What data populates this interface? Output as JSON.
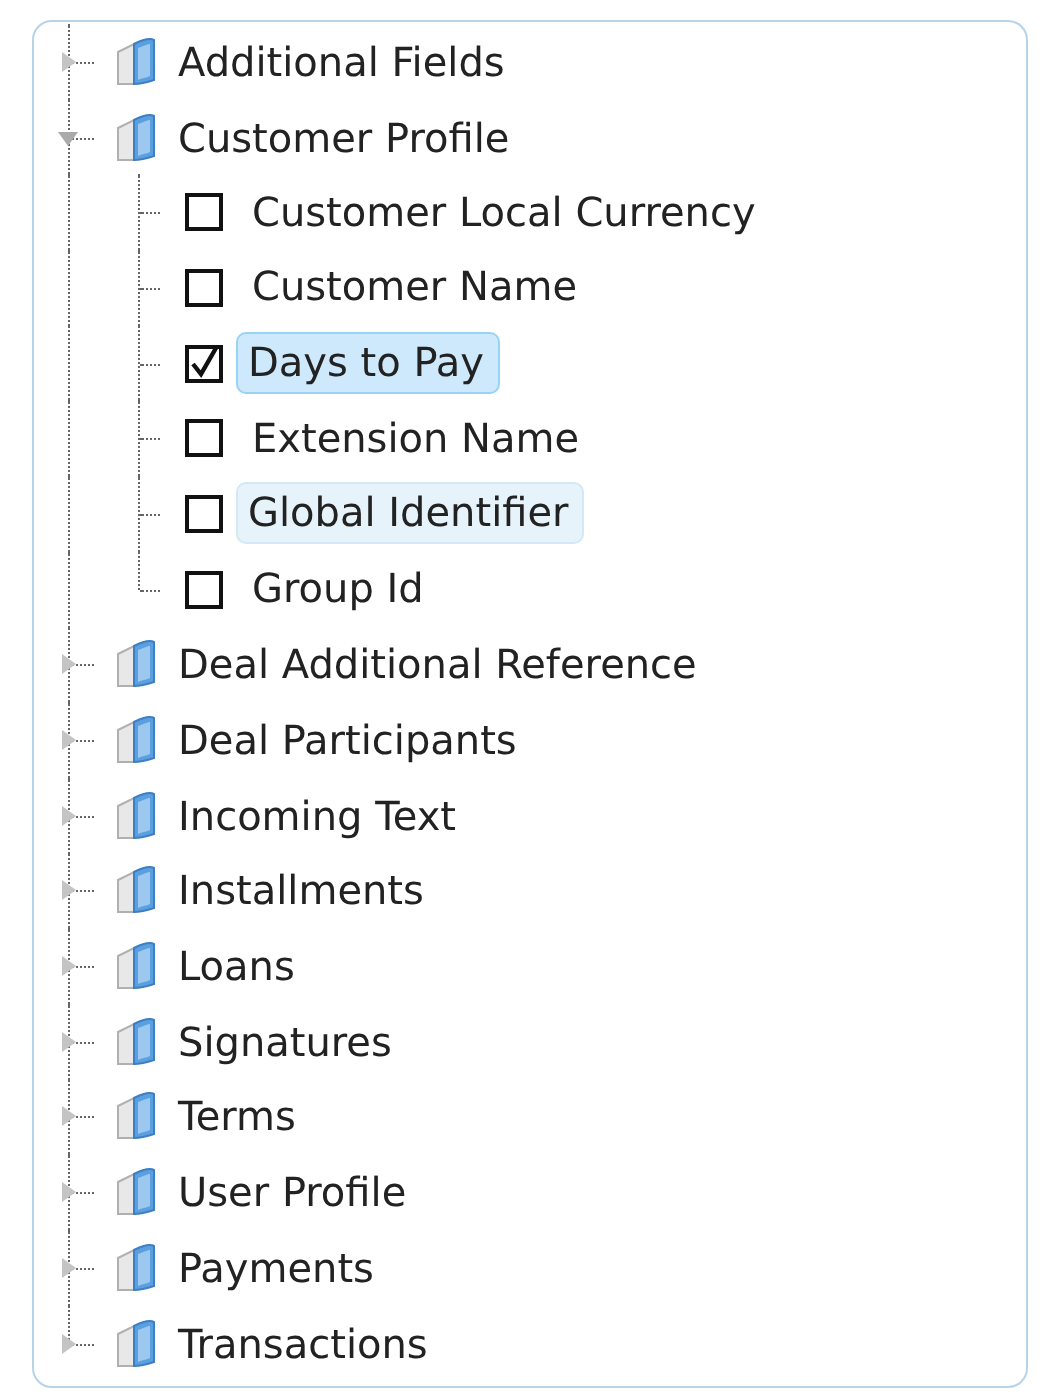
{
  "tree": {
    "items": [
      {
        "label": "Additional Fields",
        "expanded": false
      },
      {
        "label": "Customer Profile",
        "expanded": true,
        "children": [
          {
            "label": "Customer Local Currency",
            "checked": false,
            "selected": false,
            "hovered": false
          },
          {
            "label": "Customer Name",
            "checked": false,
            "selected": false,
            "hovered": false
          },
          {
            "label": "Days to Pay",
            "checked": true,
            "selected": true,
            "hovered": false
          },
          {
            "label": "Extension Name",
            "checked": false,
            "selected": false,
            "hovered": false
          },
          {
            "label": "Global Identifier",
            "checked": false,
            "selected": false,
            "hovered": true
          },
          {
            "label": "Group Id",
            "checked": false,
            "selected": false,
            "hovered": false
          }
        ]
      },
      {
        "label": "Deal Additional Reference",
        "expanded": false
      },
      {
        "label": "Deal Participants",
        "expanded": false
      },
      {
        "label": "Incoming Text",
        "expanded": false
      },
      {
        "label": "Installments",
        "expanded": false
      },
      {
        "label": "Loans",
        "expanded": false
      },
      {
        "label": "Signatures",
        "expanded": false
      },
      {
        "label": "Terms",
        "expanded": false
      },
      {
        "label": "User Profile",
        "expanded": false
      },
      {
        "label": "Payments",
        "expanded": false
      },
      {
        "label": "Transactions",
        "expanded": false
      }
    ]
  }
}
